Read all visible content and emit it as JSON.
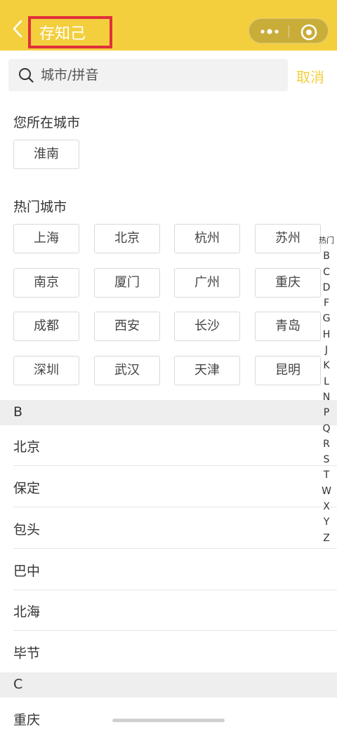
{
  "header": {
    "title": "存知己",
    "back_icon": "chevron-left-icon",
    "more_icon": "more-dots-icon",
    "close_icon": "target-close-icon",
    "bg_color": "#f3cf3e",
    "highlight_color": "#e0303a"
  },
  "search": {
    "placeholder": "城市/拼音",
    "value": "",
    "cancel_label": "取消"
  },
  "current_city": {
    "title": "您所在城市",
    "city": "淮南"
  },
  "hot_cities": {
    "title": "热门城市",
    "cities": [
      "上海",
      "北京",
      "杭州",
      "苏州",
      "南京",
      "厦门",
      "广州",
      "重庆",
      "成都",
      "西安",
      "长沙",
      "青岛",
      "深圳",
      "武汉",
      "天津",
      "昆明"
    ]
  },
  "groups": [
    {
      "letter": "B",
      "cities": [
        "北京",
        "保定",
        "包头",
        "巴中",
        "北海",
        "毕节"
      ]
    },
    {
      "letter": "C",
      "cities": [
        "重庆"
      ]
    }
  ],
  "index_bar": [
    "热门",
    "B",
    "C",
    "D",
    "F",
    "G",
    "H",
    "J",
    "K",
    "L",
    "N",
    "P",
    "Q",
    "R",
    "S",
    "T",
    "W",
    "X",
    "Y",
    "Z"
  ]
}
